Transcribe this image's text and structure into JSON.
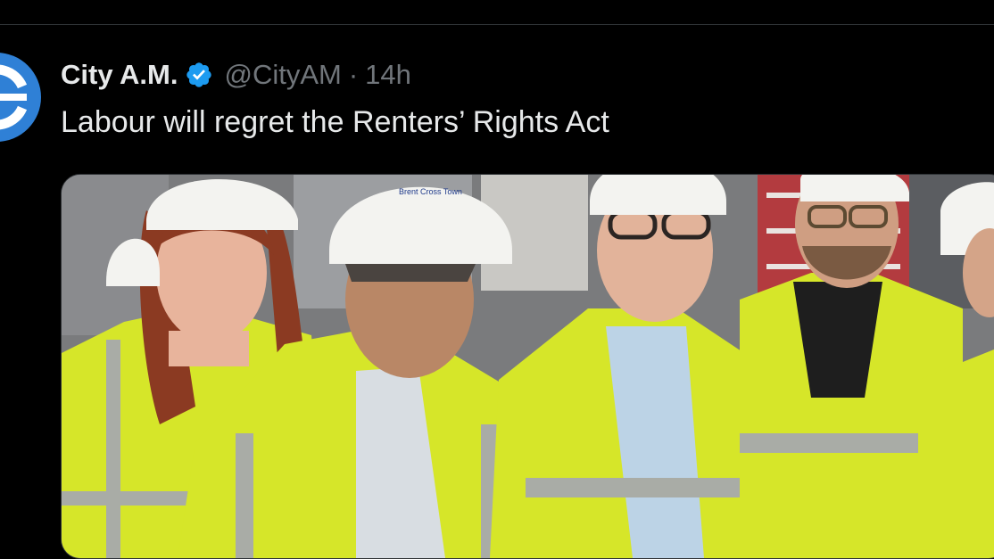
{
  "tweet": {
    "display_name": "City A.M.",
    "handle": "@CityAM",
    "separator": "·",
    "timestamp": "14h",
    "text": "Labour will regret the Renters’ Rights Act",
    "verified_icon": "verified-badge-icon",
    "avatar_icon": "city-am-logo-icon"
  },
  "media": {
    "helmet_text": "Brent Cross Town",
    "colors": {
      "hi_vis": "#d6e629",
      "reflective": "#a9aca6",
      "helmet": "#f3f3f0"
    }
  },
  "colors": {
    "background": "#000000",
    "text_primary": "#e7e9ea",
    "text_secondary": "#71767b",
    "verified": "#1d9bf0",
    "brand": "#2f80d6"
  }
}
